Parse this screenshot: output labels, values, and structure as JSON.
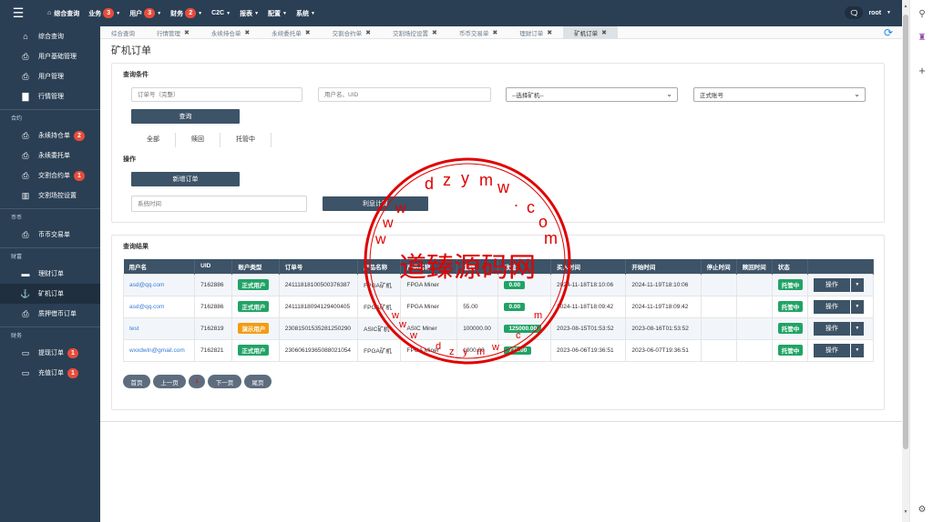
{
  "topnav": {
    "items": [
      {
        "label": "综合查询",
        "badge": null,
        "icon": "home-icon"
      },
      {
        "label": "业务",
        "badge": "3",
        "caret": true
      },
      {
        "label": "用户",
        "badge": "3",
        "caret": true
      },
      {
        "label": "财务",
        "badge": "2",
        "caret": true
      },
      {
        "label": "C2C",
        "badge": null,
        "caret": true
      },
      {
        "label": "报表",
        "badge": null,
        "caret": true
      },
      {
        "label": "配置",
        "badge": null,
        "caret": true
      },
      {
        "label": "系统",
        "badge": null,
        "caret": true
      }
    ],
    "user": "root"
  },
  "sidebar": {
    "top_items": [
      {
        "label": "综合查询",
        "icon": "home-icon"
      },
      {
        "label": "用户基础管理",
        "icon": "document-icon"
      },
      {
        "label": "用户管理",
        "icon": "document-icon"
      },
      {
        "label": "行情管理",
        "icon": "bar-chart-icon"
      }
    ],
    "group_contract": "合约",
    "contract_items": [
      {
        "label": "永续持仓单",
        "badge": "2",
        "icon": "document-icon"
      },
      {
        "label": "永续委托单",
        "badge": "",
        "icon": "document-icon"
      },
      {
        "label": "交割合约单",
        "badge": "1",
        "icon": "document-icon"
      },
      {
        "label": "交割场控设置",
        "badge": "",
        "icon": "columns-icon"
      }
    ],
    "group_coin": "币币",
    "coin_items": [
      {
        "label": "币币交易单",
        "icon": "document-icon"
      }
    ],
    "group_finance": "财富",
    "finance_items": [
      {
        "label": "理财订单",
        "icon": "folder-icon"
      },
      {
        "label": "矿机订单",
        "icon": "anchor-icon"
      },
      {
        "label": "质押借币订单",
        "icon": "document-icon"
      }
    ],
    "group_money": "财务",
    "money_items": [
      {
        "label": "提现订单",
        "badge": "1",
        "icon": "card-icon"
      },
      {
        "label": "充值订单",
        "badge": "1",
        "icon": "card-icon"
      }
    ]
  },
  "tabs": [
    {
      "label": "综合查询",
      "closable": false
    },
    {
      "label": "行情管理",
      "closable": true
    },
    {
      "label": "永续持仓单",
      "closable": true
    },
    {
      "label": "永续委托单",
      "closable": true
    },
    {
      "label": "交割合约单",
      "closable": true
    },
    {
      "label": "交割场控设置",
      "closable": true
    },
    {
      "label": "币币交易单",
      "closable": true
    },
    {
      "label": "理财订单",
      "closable": true
    },
    {
      "label": "矿机订单",
      "closable": true,
      "active": true
    }
  ],
  "page": {
    "title": "矿机订单",
    "query_title": "查询条件",
    "order_no_placeholder": "订单号（完整）",
    "user_placeholder": "用户名、UID",
    "miner_select": "--选择矿机--",
    "account_select": "正式账号",
    "query_button": "查询",
    "subtabs": [
      "全部",
      "赎回",
      "托管中"
    ],
    "ops_title": "操作",
    "add_button": "新增订单",
    "time_placeholder": "系统时间",
    "interest_button": "利息计算",
    "results_title": "查询结果"
  },
  "table": {
    "columns": [
      "用户名",
      "UID",
      "账户类型",
      "订单号",
      "产品名称",
      "产品名称",
      "金额",
      "收益",
      "买入时间",
      "开始时间",
      "停止时间",
      "赎回时间",
      "状态",
      ""
    ],
    "rows": [
      {
        "user": "asd@qq.com",
        "uid": "7162886",
        "type": "正式用户",
        "type_color": "green",
        "order": "24111818100500376387",
        "prod1": "FPGA矿机",
        "prod2": "FPGA Miner",
        "amount": "",
        "profit": "0.00",
        "buy": "2024-11-18T18:10:06",
        "start": "2024-11-19T18:10:06",
        "stop": "",
        "redeem": "",
        "status": "托管中",
        "op": "操作"
      },
      {
        "user": "asd@qq.com",
        "uid": "7162886",
        "type": "正式用户",
        "type_color": "green",
        "order": "24111818094129400405",
        "prod1": "FPGA矿机",
        "prod2": "FPGA Miner",
        "amount": "55.00",
        "profit": "0.00",
        "buy": "2024-11-18T18:09:42",
        "start": "2024-11-19T18:09:42",
        "stop": "",
        "redeem": "",
        "status": "托管中",
        "op": "操作"
      },
      {
        "user": "test",
        "uid": "7162819",
        "type": "演示用户",
        "type_color": "orange",
        "order": "23081501535281250290",
        "prod1": "ASIC矿机",
        "prod2": "ASIC Miner",
        "amount": "100000.00",
        "profit": "125000.00",
        "buy": "2023-08-15T01:53:52",
        "start": "2023-08-16T01:53:52",
        "stop": "",
        "redeem": "",
        "status": "托管中",
        "op": "操作"
      },
      {
        "user": "wxxdwln@gmail.com",
        "uid": "7162821",
        "type": "正式用户",
        "type_color": "green",
        "order": "23060619365088021054",
        "prod1": "FPGA矿机",
        "prod2": "FPGA Miner",
        "amount": "1000.00",
        "profit": "775.00",
        "buy": "2023-06-06T19:36:51",
        "start": "2023-06-07T19:36:51",
        "stop": "",
        "redeem": "",
        "status": "托管中",
        "op": "操作"
      }
    ]
  },
  "pagination": {
    "first": "首页",
    "prev": "上一页",
    "current": "1",
    "next": "下一页",
    "last": "尾页"
  },
  "watermark": {
    "center_text": "道臻源码网",
    "ring_text": "dzymw.com",
    "inner_text": "wwdzymw.com"
  },
  "colors": {
    "nav_bg": "#2a3f54",
    "badge": "#e74c3c",
    "tag_green": "#21a366",
    "tag_orange": "#f39c12",
    "watermark": "#e00000"
  }
}
